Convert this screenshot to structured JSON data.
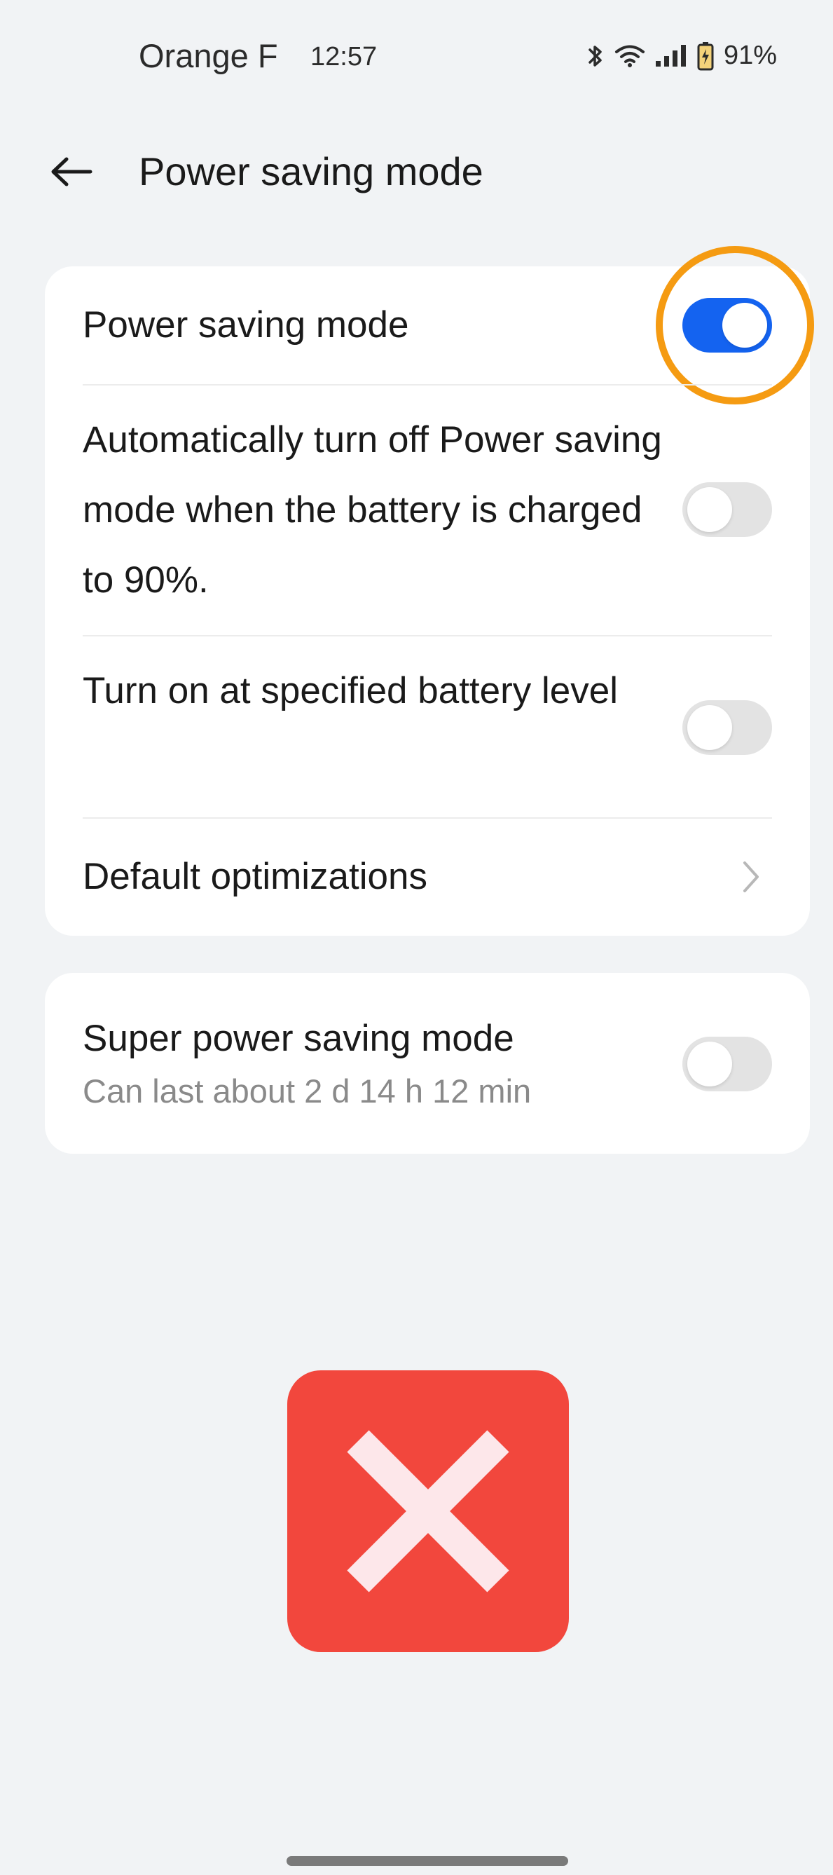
{
  "status_bar": {
    "carrier": "Orange F",
    "time": "12:57",
    "battery_percent": "91%",
    "icons": [
      "bluetooth-icon",
      "wifi-icon",
      "signal-icon",
      "battery-charging-icon"
    ]
  },
  "app_bar": {
    "back_icon": "arrow-left-icon",
    "title": "Power saving mode"
  },
  "settings": {
    "power_saving": {
      "label": "Power saving mode",
      "enabled": true
    },
    "auto_off": {
      "label": "Automatically turn off Power saving mode when the battery is charged to 90%.",
      "enabled": false
    },
    "battery_level": {
      "label": "Turn on at specified battery level",
      "enabled": false
    },
    "default_optimizations": {
      "label": "Default optimizations",
      "icon": "chevron-right-icon"
    },
    "super_power_saving": {
      "label": "Super power saving mode",
      "sublabel": "Can last about 2 d 14 h 12 min",
      "enabled": false
    }
  },
  "colors": {
    "toggle_on": "#1463f0",
    "toggle_off": "#e3e3e3",
    "highlight_ring": "#f59b12",
    "reject_badge": "#f2473d",
    "background": "#f1f3f5"
  },
  "overlay": {
    "highlight_target": "power-saving-toggle",
    "badge_icon": "close-x-icon"
  }
}
